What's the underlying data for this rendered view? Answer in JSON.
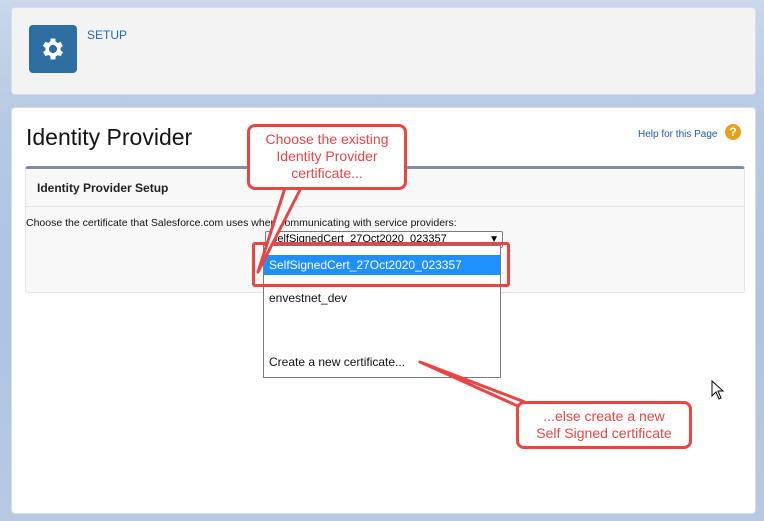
{
  "header": {
    "app_label": "SETUP",
    "icon": "gear-icon"
  },
  "page": {
    "title": "Identity Provider",
    "help_link": "Help for this Page",
    "help_icon_glyph": "?"
  },
  "section": {
    "title": "Identity Provider Setup",
    "description": "Choose the certificate that Salesforce.com uses when communicating with service providers:"
  },
  "certificate_select": {
    "selected_value": "SelfSignedCert_27Oct2020_023357",
    "options": [
      "SelfSignedCert_27Oct2020_023357",
      "envestnet_dev",
      "Create a new certificate..."
    ]
  },
  "annotations": {
    "callout_top": [
      "Choose the existing",
      "Identity Provider",
      "certificate..."
    ],
    "callout_bottom": [
      "...else create a new",
      "Self Signed certificate"
    ],
    "accent_color": "#e84545"
  },
  "colors": {
    "setup_icon_bg": "#2e6fa3",
    "selected_option_bg": "#1e90ff",
    "help_icon_bg": "#e7a11b"
  }
}
